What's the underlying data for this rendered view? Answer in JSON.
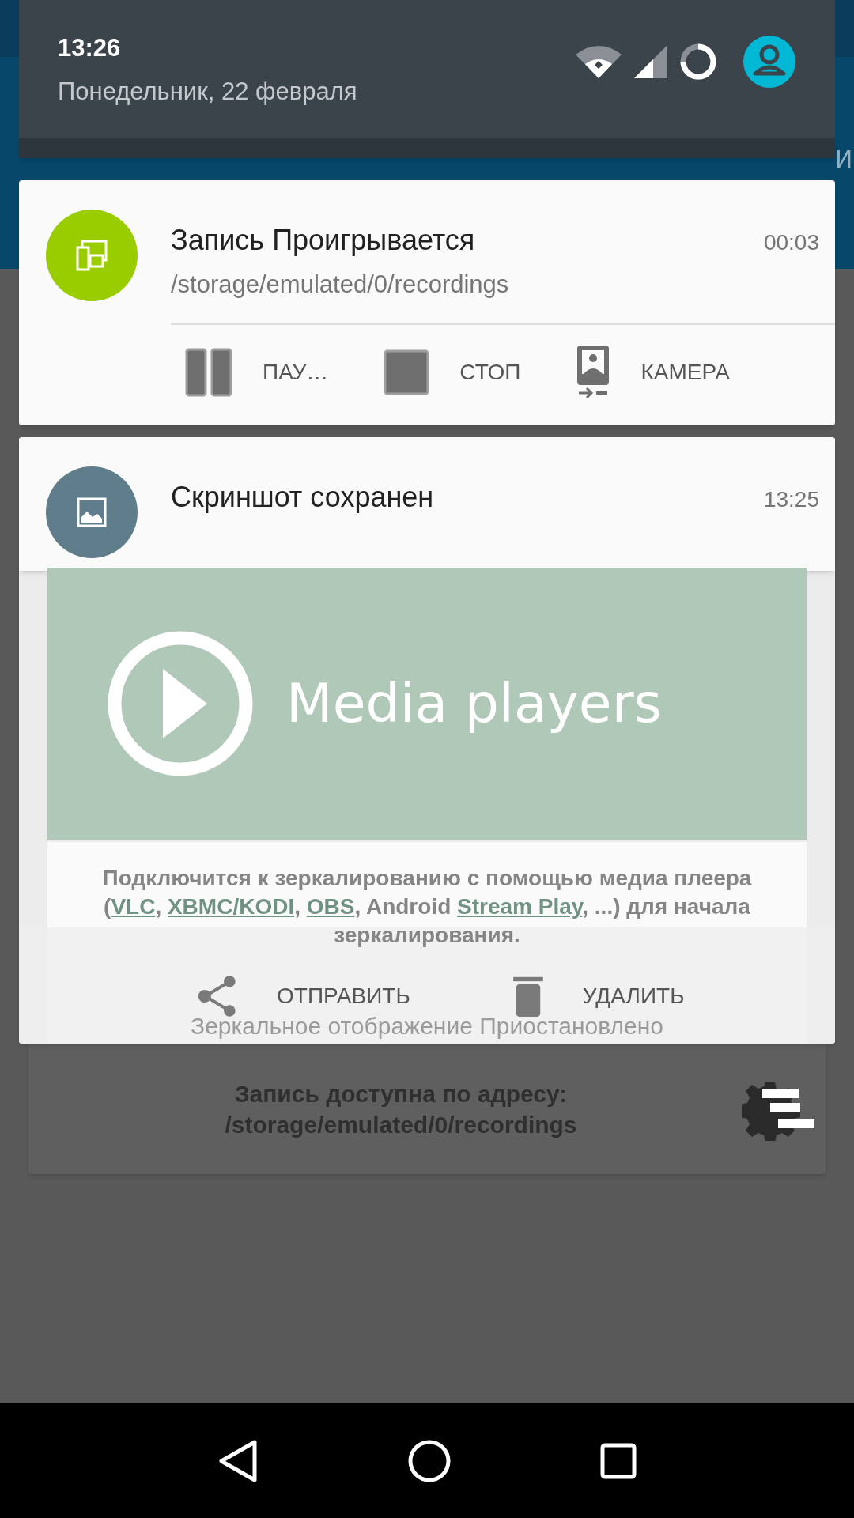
{
  "background_fragment": "и",
  "quick_settings": {
    "time": "13:26",
    "date": "Понедельник, 22 февраля"
  },
  "notifications": [
    {
      "kind": "recording",
      "title": "Запись Проигрывается",
      "time": "00:03",
      "text": "/storage/emulated/0/recordings",
      "color": "#9acd00",
      "actions": [
        {
          "kind": "pause",
          "label": "ПАУ…"
        },
        {
          "kind": "stop",
          "label": "СТОП"
        },
        {
          "kind": "camera",
          "label": "КАМЕРА"
        }
      ]
    },
    {
      "kind": "screenshot",
      "title": "Скриншот сохранен",
      "time": "13:25",
      "color": "#607d8b",
      "preview": {
        "banner": "Media players",
        "text_parts": [
          {
            "text": "Подключится к зеркалированию с помощью медиа плеера (",
            "link": false
          },
          {
            "text": "VLC",
            "link": true
          },
          {
            "text": ", ",
            "link": false
          },
          {
            "text": "XBMC/KODI",
            "link": true
          },
          {
            "text": ", ",
            "link": false
          },
          {
            "text": "OBS",
            "link": true
          },
          {
            "text": ", Android ",
            "link": false
          },
          {
            "text": "Stream Play",
            "link": true
          },
          {
            "text": ", ...) для начала зеркалирования.",
            "link": false
          }
        ],
        "status": "Зеркальное отображение Приостановлено"
      },
      "actions": [
        {
          "kind": "share",
          "label": "ОТПРАВИТЬ"
        },
        {
          "kind": "delete",
          "label": "УДАЛИТЬ"
        }
      ]
    }
  ],
  "app_card": {
    "lines": [
      "Запись доступна по адресу:",
      "/storage/emulated/0/recordings"
    ]
  }
}
